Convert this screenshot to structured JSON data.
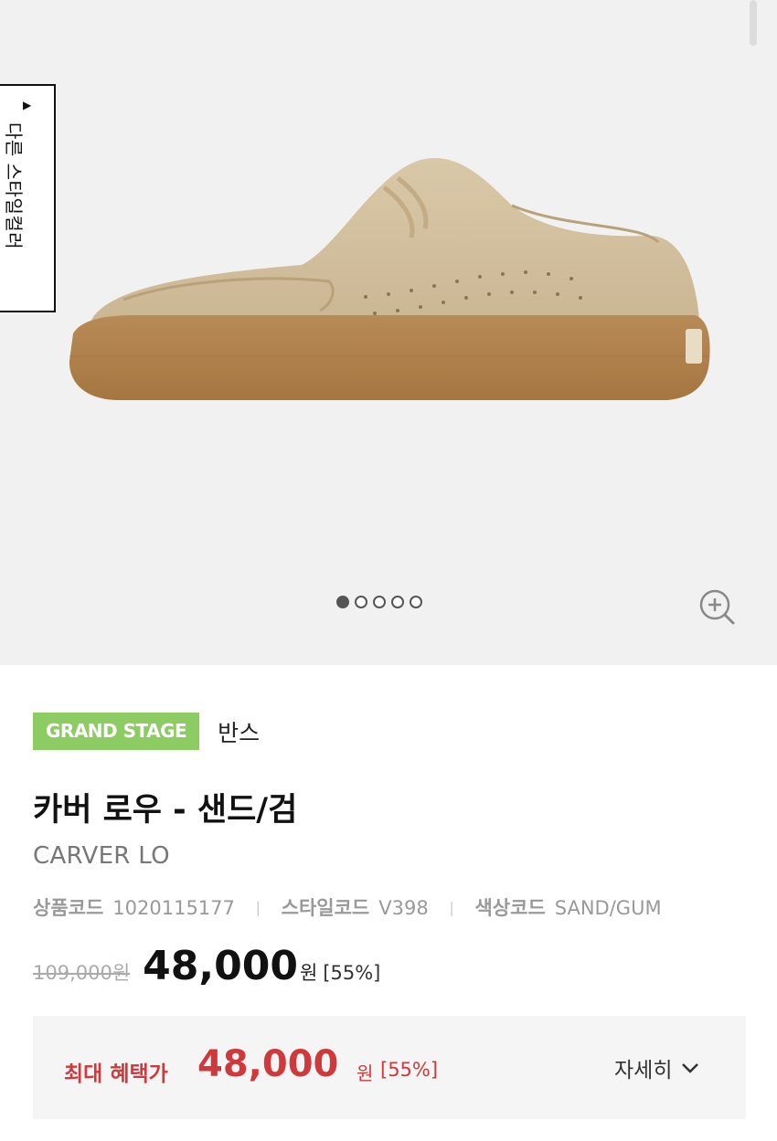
{
  "gallery": {
    "style_gallery_label": "다른 스타일컬러",
    "slide_count": 5,
    "active_slide": 1
  },
  "product": {
    "badge": "GRAND STAGE",
    "brand": "반스",
    "name_ko": "카버 로우 - 샌드/검",
    "name_en": "CARVER LO",
    "codes": [
      {
        "key": "상품코드",
        "value": "1020115177"
      },
      {
        "key": "스타일코드",
        "value": "V398"
      },
      {
        "key": "색상코드",
        "value": "SAND/GUM"
      }
    ],
    "original_price": "109,000원",
    "sale_price": "48,000",
    "currency": "원",
    "discount": "[55%]"
  },
  "benefit": {
    "label": "최대 혜택가",
    "price": "48,000",
    "currency": "원",
    "discount": "[55%]",
    "detail_label": "자세히"
  },
  "colors": {
    "badge_green": "#8dcc63",
    "benefit_red": "#d0393c",
    "hero_bg": "#f1f1f1"
  }
}
